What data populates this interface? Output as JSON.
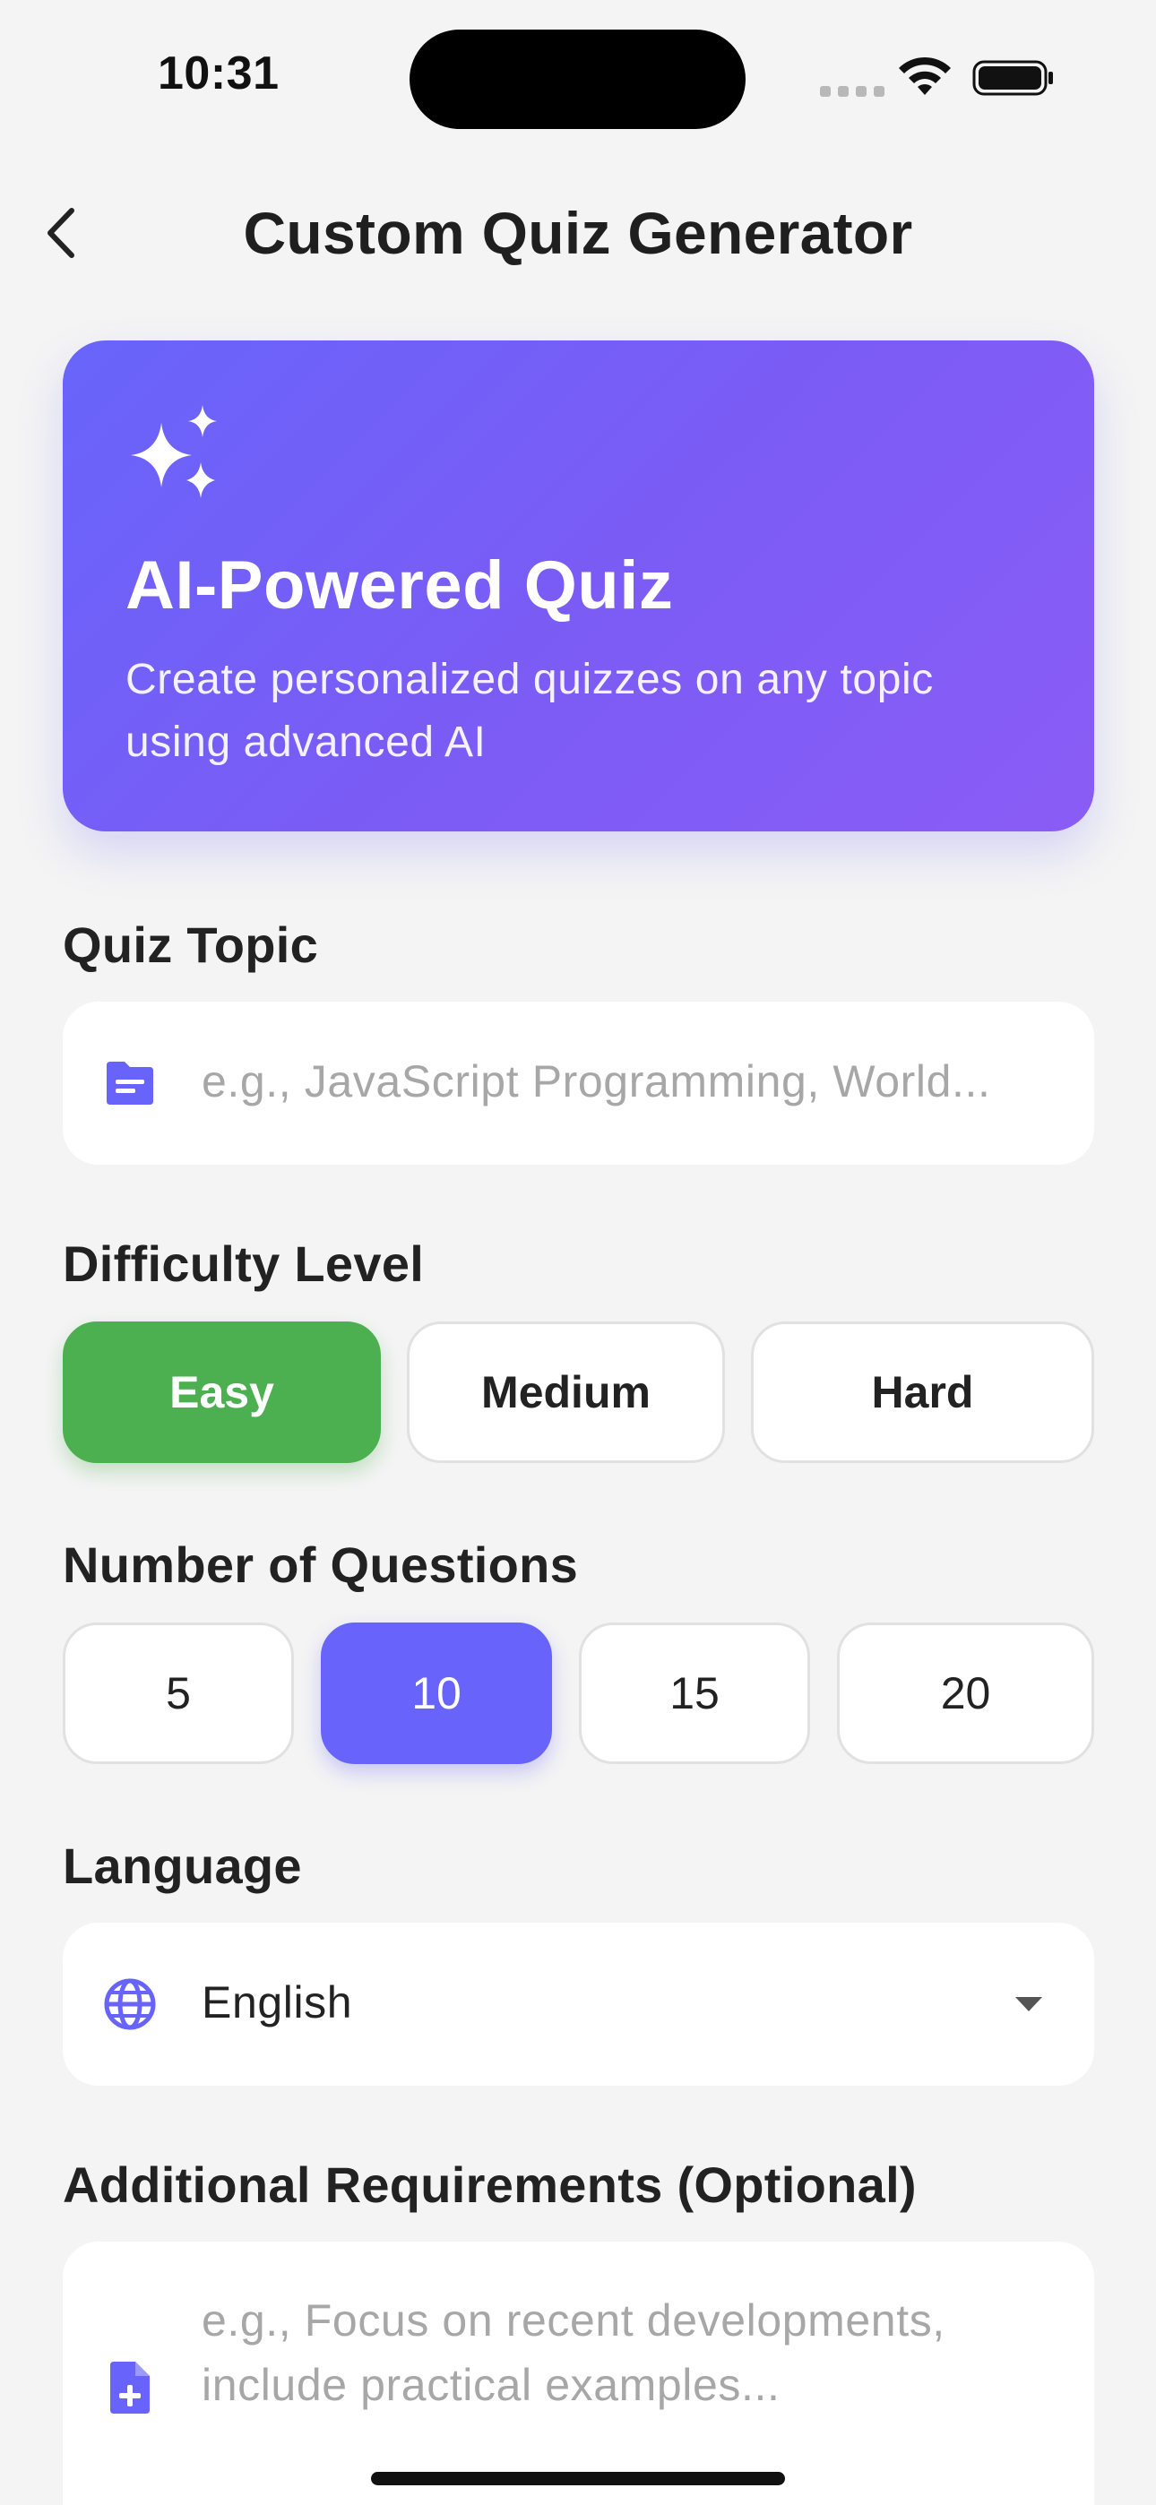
{
  "status_bar": {
    "time": "10:31"
  },
  "header": {
    "title": "Custom Quiz Generator"
  },
  "hero": {
    "title": "AI-Powered Quiz",
    "subtitle": "Create personalized quizzes on any topic using advanced AI"
  },
  "topic": {
    "label": "Quiz Topic",
    "placeholder": "e.g., JavaScript Programming, World..."
  },
  "difficulty": {
    "label": "Difficulty Level",
    "options": [
      "Easy",
      "Medium",
      "Hard"
    ],
    "selected": "Easy"
  },
  "questions": {
    "label": "Number of Questions",
    "options": [
      "5",
      "10",
      "15",
      "20"
    ],
    "selected": "10"
  },
  "language": {
    "label": "Language",
    "value": "English"
  },
  "requirements": {
    "label": "Additional Requirements (Optional)",
    "placeholder": "e.g., Focus on recent developments, include practical examples..."
  },
  "colors": {
    "accent": "#6864fb",
    "hero_gradient_end": "#8b5cf6",
    "selected_difficulty": "#4caf50",
    "background": "#f4f4f4"
  },
  "icons": {
    "back": "chevron-left-icon",
    "hero": "sparkles-icon",
    "topic": "document-icon",
    "language": "globe-icon",
    "dropdown": "caret-down-icon",
    "requirements": "file-plus-icon"
  }
}
